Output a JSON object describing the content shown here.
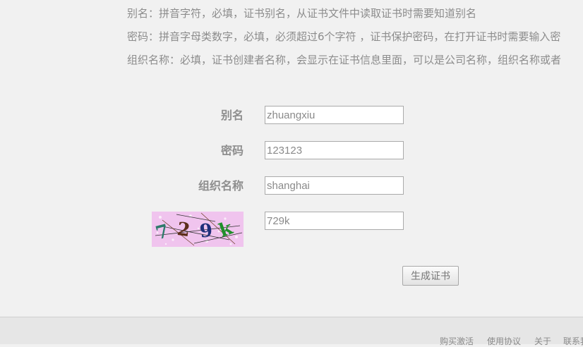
{
  "info": {
    "alias_desc": "别名：拼音字符，必填，证书别名，从证书文件中读取证书时需要知道别名",
    "password_desc": "密码：拼音字母类数字，必填，必须超过6个字符 ，证书保护密码，在打开证书时需要输入密",
    "org_desc": "组织名称：必填，证书创建者名称，会显示在证书信息里面，可以是公司名称，组织名称或者"
  },
  "form": {
    "alias_label": "别名",
    "alias_value": "zhuangxiu",
    "password_label": "密码",
    "password_value": "123123",
    "org_label": "组织名称",
    "org_value": "shanghai",
    "captcha_value": "729k",
    "captcha_image_text": "729k"
  },
  "button": {
    "generate_label": "生成证书"
  },
  "footer": {
    "links": [
      "购买激活",
      "使用协议",
      "关于",
      "联系我"
    ]
  }
}
